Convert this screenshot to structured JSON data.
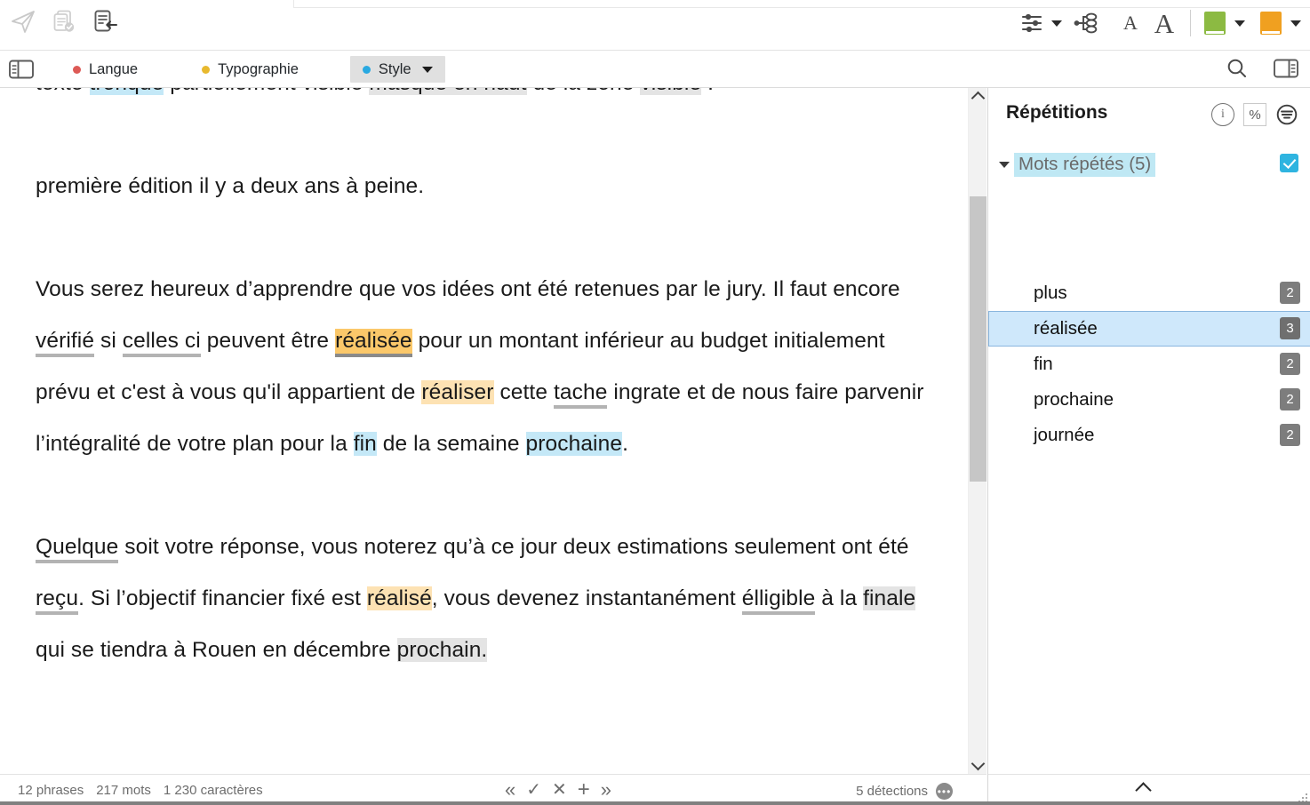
{
  "toolbar": {
    "left_icons": [
      {
        "name": "send-icon",
        "state": "disabled"
      },
      {
        "name": "document-check-icon",
        "state": "disabled"
      },
      {
        "name": "document-import-icon",
        "state": "enabled"
      }
    ],
    "right_icons": [
      {
        "name": "settings-sliders-icon",
        "label": ""
      },
      {
        "name": "settings-dropdown-caret-icon",
        "label": ""
      },
      {
        "name": "structure-tree-icon",
        "label": ""
      },
      {
        "name": "font-small-icon",
        "label": "A"
      },
      {
        "name": "font-large-icon",
        "label": "A"
      },
      {
        "name": "dictionary-green-icon",
        "label": "",
        "color": "#8cba42"
      },
      {
        "name": "dictionary-green-caret-icon",
        "label": ""
      },
      {
        "name": "dictionary-orange-icon",
        "label": "",
        "color": "#f0a020"
      },
      {
        "name": "dictionary-orange-caret-icon",
        "label": ""
      }
    ]
  },
  "tabbar": {
    "left_toggle": "left-panel-toggle-icon",
    "tabs": [
      {
        "label": "Langue",
        "color": "#dd5a56",
        "active": false,
        "has_caret": false
      },
      {
        "label": "Typographie",
        "color": "#e8b92e",
        "active": false,
        "has_caret": false
      },
      {
        "label": "Style",
        "color": "#29a9e1",
        "active": true,
        "has_caret": true
      }
    ],
    "right_icons": [
      "search-icon",
      "right-panel-toggle-icon"
    ]
  },
  "document": {
    "paragraphs": [
      {
        "id": "p-clipped",
        "clipped": true,
        "runs": [
          {
            "t": "texte ",
            "hl": "none"
          },
          {
            "t": "tronqué",
            "hl": "blue"
          },
          {
            "t": " partiellement visible ",
            "hl": "none"
          },
          {
            "t": "masqué en haut",
            "hl": "grayline"
          },
          {
            "t": " de la zone ",
            "hl": "none"
          },
          {
            "t": "visible",
            "hl": "gray"
          },
          {
            "t": " .",
            "hl": "none"
          }
        ]
      },
      {
        "id": "p1",
        "runs": [
          {
            "t": "première édition il y a deux ans à peine.",
            "hl": "none"
          }
        ]
      },
      {
        "id": "p2",
        "runs": [
          {
            "t": "Vous serez heureux d’apprendre que vos idées ont été  retenues par le jury. Il faut encore ",
            "hl": "none"
          },
          {
            "t": "vérifié",
            "hl": "none",
            "ul": "gray"
          },
          {
            "t": " si ",
            "hl": "none"
          },
          {
            "t": "celles ci",
            "hl": "none",
            "ul": "gray"
          },
          {
            "t": " peuvent être ",
            "hl": "none"
          },
          {
            "t": "réalisée",
            "hl": "orange-strong",
            "ul": "dark"
          },
          {
            "t": " pour un montant  inférieur au budget initialement prévu et c'est à vous qu'il appartient de ",
            "hl": "none"
          },
          {
            "t": "réaliser",
            "hl": "orange"
          },
          {
            "t": " cette ",
            "hl": "none"
          },
          {
            "t": "tache",
            "hl": "none",
            "ul": "gray"
          },
          {
            "t": " ingrate et de nous faire parvenir l’intégralité de votre plan pour la ",
            "hl": "none"
          },
          {
            "t": "fin",
            "hl": "blue"
          },
          {
            "t": " de la semaine ",
            "hl": "none"
          },
          {
            "t": "prochaine",
            "hl": "blue"
          },
          {
            "t": ".",
            "hl": "none"
          }
        ]
      },
      {
        "id": "p3",
        "runs": [
          {
            "t": "Quelque",
            "hl": "none",
            "ul": "gray"
          },
          {
            "t": " soit votre réponse, vous noterez qu’à ce jour deux estimations seulement ont été ",
            "hl": "none"
          },
          {
            "t": "reçu",
            "hl": "none",
            "ul": "gray"
          },
          {
            "t": ". Si l’objectif financier fixé est ",
            "hl": "none"
          },
          {
            "t": "réalisé",
            "hl": "orange"
          },
          {
            "t": ", vous devenez instantanément ",
            "hl": "none"
          },
          {
            "t": "élligible",
            "hl": "none",
            "ul": "gray"
          },
          {
            "t": " à la ",
            "hl": "none"
          },
          {
            "t": "finale",
            "hl": "gray"
          },
          {
            "t": " qui se tiendra à Rouen en décembre ",
            "hl": "none"
          },
          {
            "t": "prochain.",
            "hl": "gray"
          }
        ]
      }
    ]
  },
  "statusbar": {
    "sentences": "12 phrases",
    "words": "217 mots",
    "characters": "1 230 caractères",
    "nav": [
      {
        "name": "first-correction-button",
        "glyph": "«"
      },
      {
        "name": "accept-correction-button",
        "glyph": "✓"
      },
      {
        "name": "reject-correction-button",
        "glyph": "✕"
      },
      {
        "name": "add-to-dictionary-button",
        "glyph": "+"
      },
      {
        "name": "next-correction-button",
        "glyph": "»"
      }
    ],
    "detections": "5 détections",
    "detections_menu_glyph": "•••"
  },
  "right_panel": {
    "title": "Répétitions",
    "header_icons": [
      {
        "name": "info-icon",
        "glyph": "i"
      },
      {
        "name": "percent-toggle-button",
        "glyph": "%"
      },
      {
        "name": "filter-icon",
        "glyph": "≡"
      }
    ],
    "group": {
      "label": "Mots répétés (5)",
      "expanded": true,
      "checked": true
    },
    "items": [
      {
        "label": "plus",
        "count": "2",
        "selected": false
      },
      {
        "label": "réalisée",
        "count": "3",
        "selected": true
      },
      {
        "label": "fin",
        "count": "2",
        "selected": false
      },
      {
        "label": "prochaine",
        "count": "2",
        "selected": false
      },
      {
        "label": "journée",
        "count": "2",
        "selected": false
      }
    ],
    "footer": {
      "collapse_icon": "chevron-up-icon",
      "resize_grip": "resize-grip-icon"
    }
  },
  "colors": {
    "accent_blue": "#29a9e1",
    "selection_blue": "#cfe8fb",
    "group_highlight": "#bfe8f4",
    "highlight_orange_strong": "#fbc86a",
    "highlight_orange": "#fde2b3",
    "highlight_blue": "#c4e8f7",
    "highlight_gray": "#e4e4e4",
    "count_badge": "#7d7d7d"
  }
}
